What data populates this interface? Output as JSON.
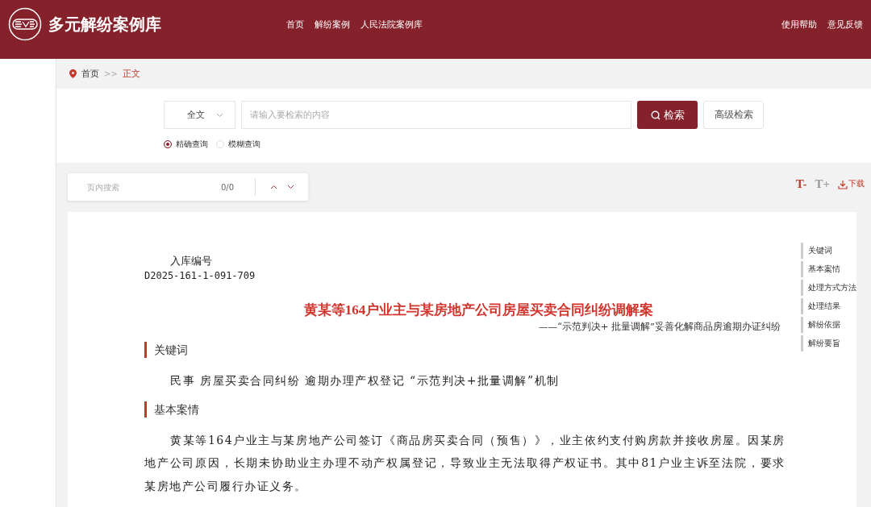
{
  "header": {
    "site_title": "多元解纷案例库",
    "nav": [
      {
        "label": "首页"
      },
      {
        "label": "解纷案例"
      },
      {
        "label": "人民法院案例库"
      }
    ],
    "right_links": [
      {
        "label": "使用帮助"
      },
      {
        "label": "意见反馈"
      }
    ]
  },
  "breadcrumb": [
    {
      "label": "首页",
      "selected": false
    },
    {
      "label": "正文",
      "selected": true
    }
  ],
  "breadcrumb_separator": ">>",
  "search": {
    "scope": "全文",
    "placeholder": "请输入要检索的内容",
    "button": "检索",
    "advanced": "高级检索",
    "modes": [
      {
        "label": "精确查询",
        "selected": true
      },
      {
        "label": "模糊查询",
        "selected": false
      }
    ]
  },
  "page_search": {
    "placeholder": "页内搜索",
    "count": "0/0"
  },
  "tools": {
    "font_sizes": [
      {
        "label": "T-",
        "selected": true
      },
      {
        "label": "T+",
        "selected": false
      }
    ],
    "download": "下载"
  },
  "document": {
    "id_label": "入库编号",
    "id": "D2025-161-1-091-709",
    "title": "黄某等164户业主与某房地产公司房屋买卖合同纠纷调解案",
    "subtitle": "——“示范判决+ 批量调解”妥善化解商品房逾期办证纠纷",
    "sections": [
      {
        "heading": "关键词",
        "text": "民事 房屋买卖合同纠纷 逾期办理产权登记 “示范判决+批量调解”机制"
      },
      {
        "heading": "基本案情",
        "text": "黄某等164户业主与某房地产公司签订《商品房买卖合同（预售）》，业主依约支付购房款并接收房屋。因某房地产公司原因，长期未协助业主办理不动产权属登记，导致业主无法取得产权证书。其中81户业主诉至法院，要求某房地产公司履行办证义务。"
      }
    ]
  },
  "toc": [
    {
      "label": "关键词"
    },
    {
      "label": "基本案情"
    },
    {
      "label": "处理方式方法"
    },
    {
      "label": "处理结果"
    },
    {
      "label": "解纷依据"
    },
    {
      "label": "解纷要旨"
    }
  ]
}
